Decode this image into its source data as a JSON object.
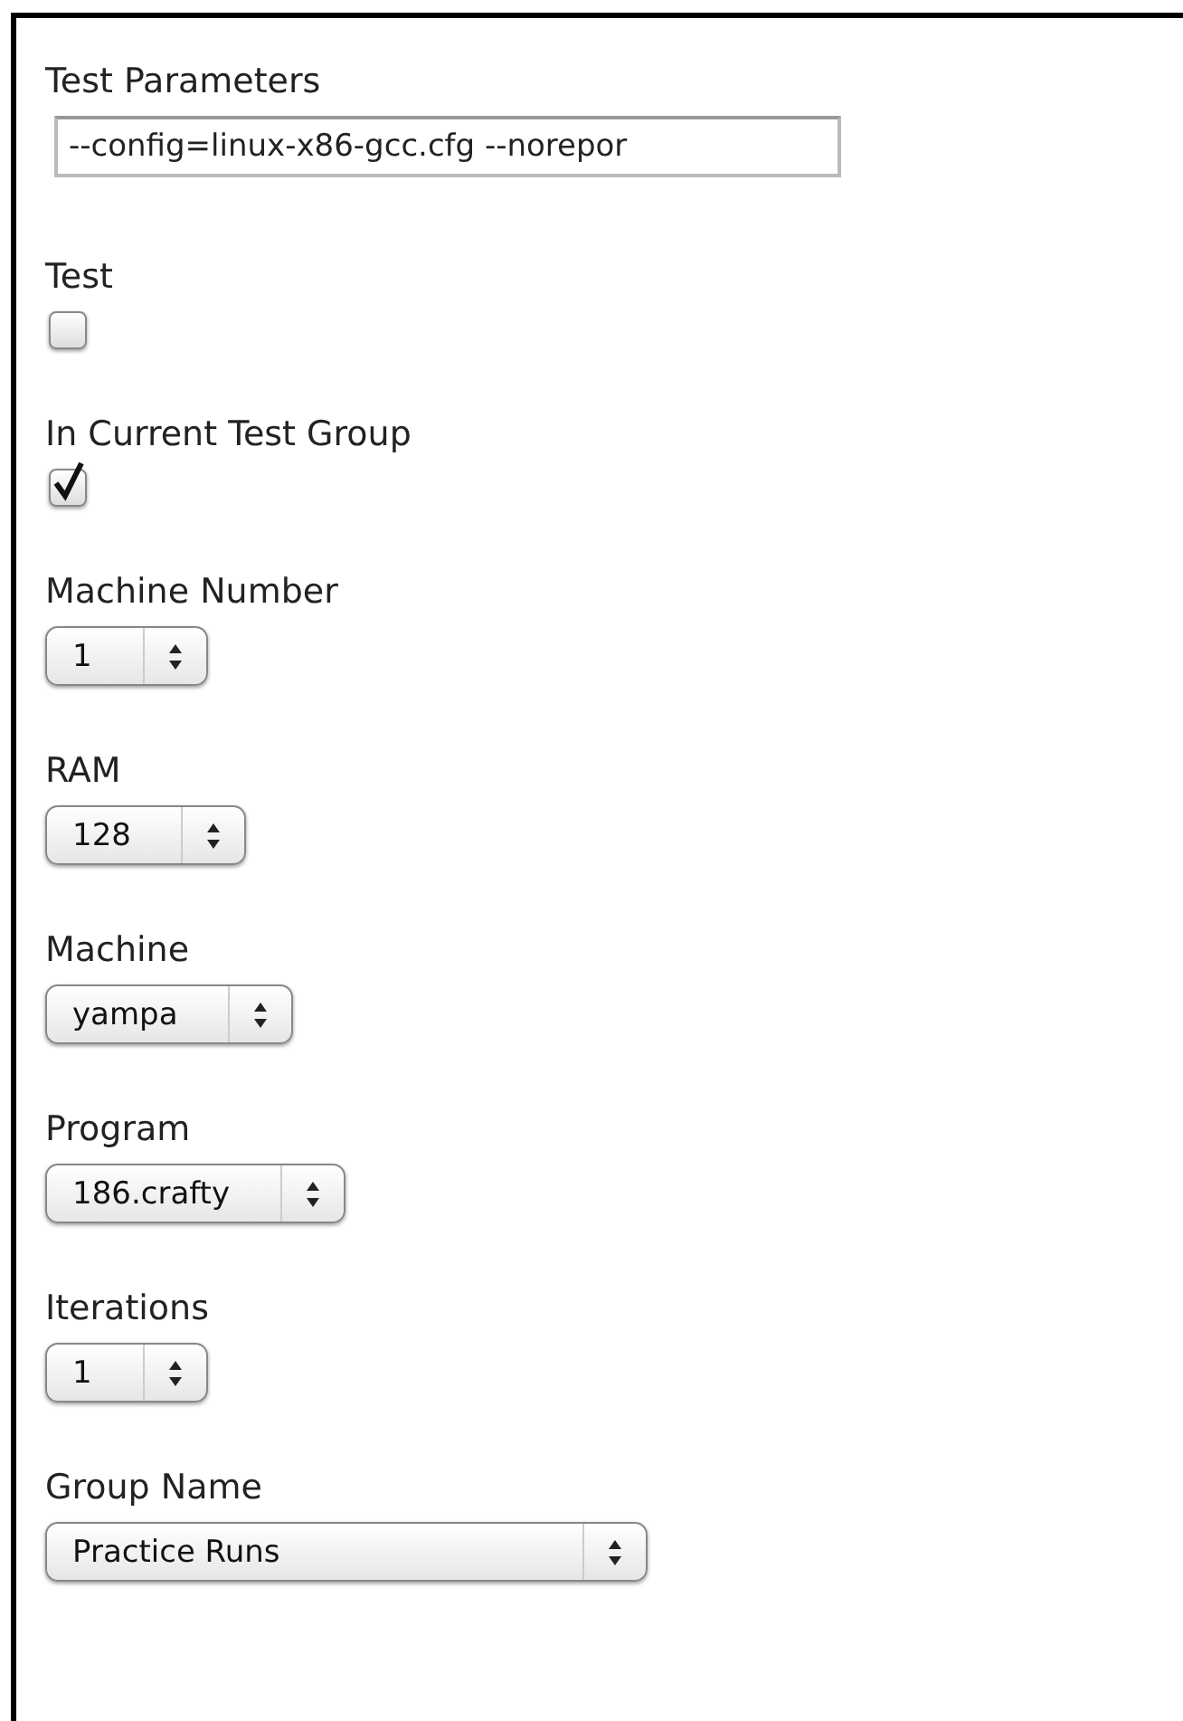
{
  "fields": [
    {
      "kind": "text",
      "label": "Test Parameters",
      "value": "--config=linux-x86-gcc.cfg --norepor"
    },
    {
      "kind": "checkbox",
      "label": "Test",
      "checked": false
    },
    {
      "kind": "checkbox",
      "label": "In Current Test Group",
      "checked": true
    },
    {
      "kind": "select",
      "label": "Machine Number",
      "value": "1"
    },
    {
      "kind": "select",
      "label": "RAM",
      "value": "128"
    },
    {
      "kind": "select",
      "label": "Machine",
      "value": "yampa"
    },
    {
      "kind": "select",
      "label": "Program",
      "value": "186.crafty"
    },
    {
      "kind": "select",
      "label": "Iterations",
      "value": "1"
    },
    {
      "kind": "select",
      "label": "Group Name",
      "value": "Practice Runs"
    }
  ]
}
